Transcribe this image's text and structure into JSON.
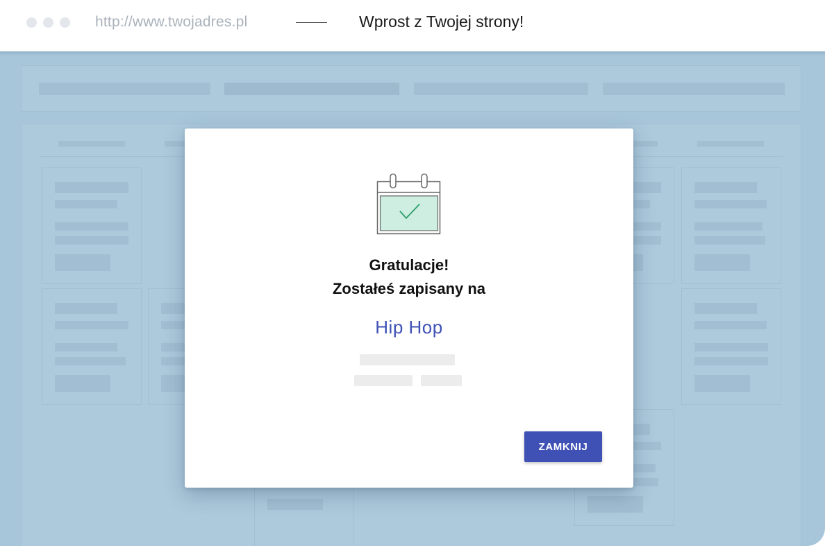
{
  "browser": {
    "url": "http://www.twojadres.pl",
    "page_title": "Wprost z Twojej strony!"
  },
  "modal": {
    "icon": "calendar-check-icon",
    "heading_line1": "Gratulacje!",
    "heading_line2": "Zostałeś zapisany na",
    "event_name": "Hip Hop",
    "close_button": "ZAMKNIJ"
  },
  "colors": {
    "accent": "#3f51b5",
    "overlay_background": "#a8c6da",
    "calendar_fill": "#cdeee0",
    "check": "#2e9e6e"
  }
}
